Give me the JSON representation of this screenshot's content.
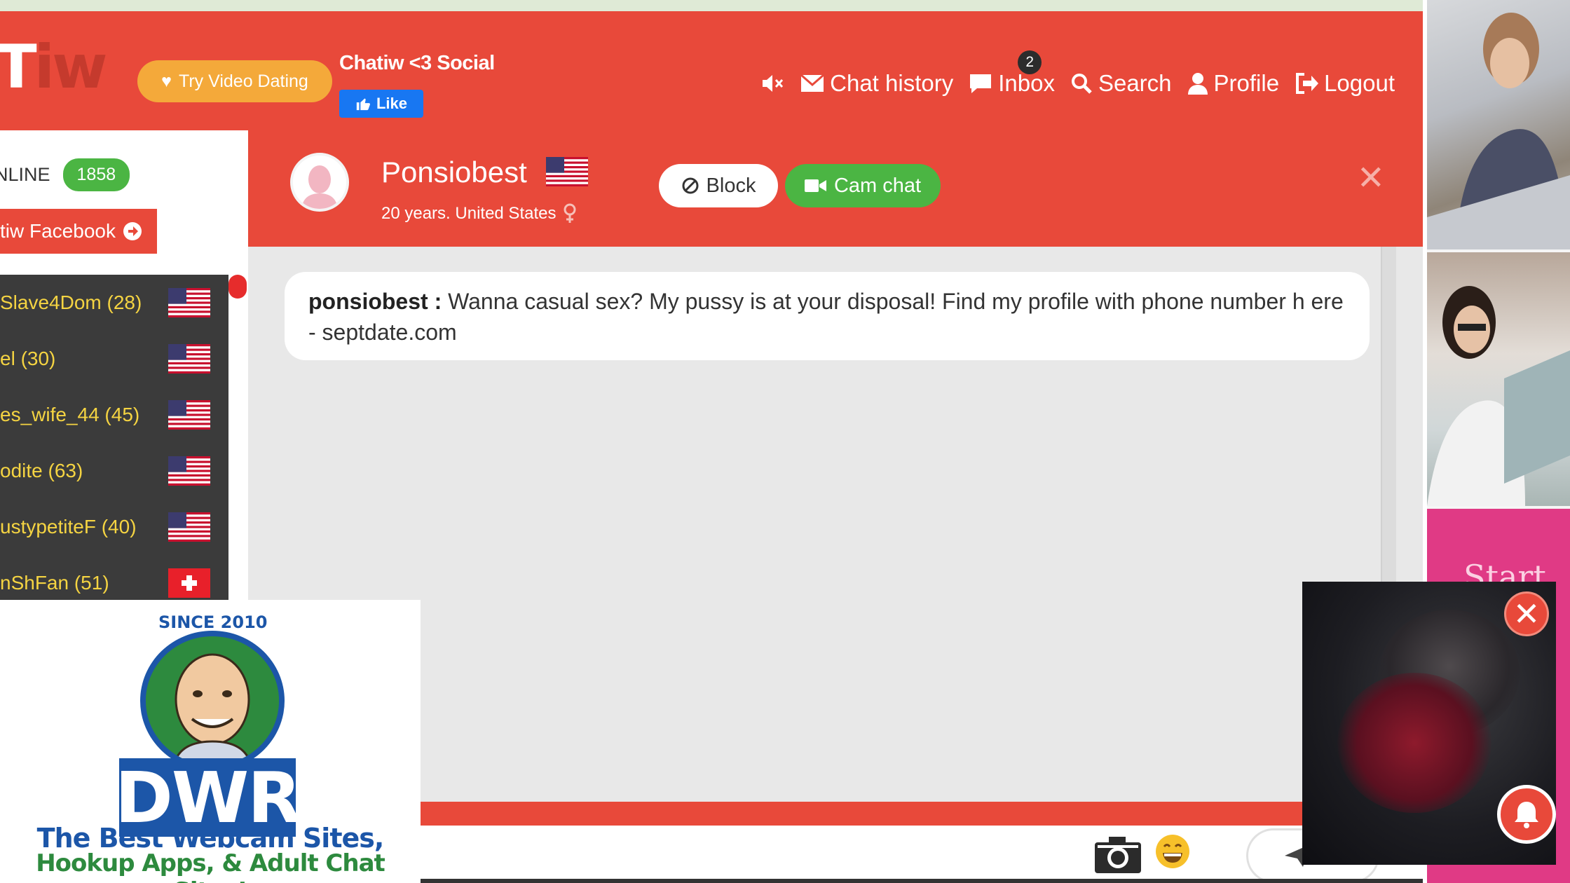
{
  "header": {
    "brand": "Chatiw <3 Social",
    "try_video_label": "Try Video Dating",
    "like_label": "Like",
    "nav": {
      "chat_history": "Chat history",
      "inbox": "Inbox",
      "inbox_badge": "2",
      "search": "Search",
      "profile": "Profile",
      "logout": "Logout"
    }
  },
  "sidebar": {
    "online_label": "NLINE",
    "online_count": "1858",
    "facebook_label": "tiw Facebook",
    "users": [
      {
        "name": "Slave4Dom (28)",
        "flag": "us"
      },
      {
        "name": "el (30)",
        "flag": "us"
      },
      {
        "name": "es_wife_44 (45)",
        "flag": "us"
      },
      {
        "name": "odite (63)",
        "flag": "us"
      },
      {
        "name": "ustypetiteF (40)",
        "flag": "us"
      },
      {
        "name": "nShFan (51)",
        "flag": "ch"
      }
    ]
  },
  "chat": {
    "partner_name": "Ponsiobest",
    "partner_info": "20 years. United States",
    "block_label": "Block",
    "cam_chat_label": "Cam chat",
    "messages": [
      {
        "sender": "ponsiobest :",
        "text": " Wanna casual sex? My pussy is at your disposal! Find my profile with phone number h ere -  septdate.com"
      }
    ]
  },
  "promo": {
    "since": "SINCE 2010",
    "logo": "DWR",
    "tagline_1": "The Best Webcam Sites,",
    "tagline_2": "Hookup Apps, & Adult Chat Sites!"
  },
  "right_rail": {
    "pink_ad_text": "Start"
  },
  "colors": {
    "header_red": "#e8493a",
    "online_green": "#4bb543",
    "try_video_orange": "#f4a93a",
    "facebook_blue": "#1877f2",
    "sidebar_dark": "#3b3b3b",
    "username_yellow": "#f5d442"
  }
}
